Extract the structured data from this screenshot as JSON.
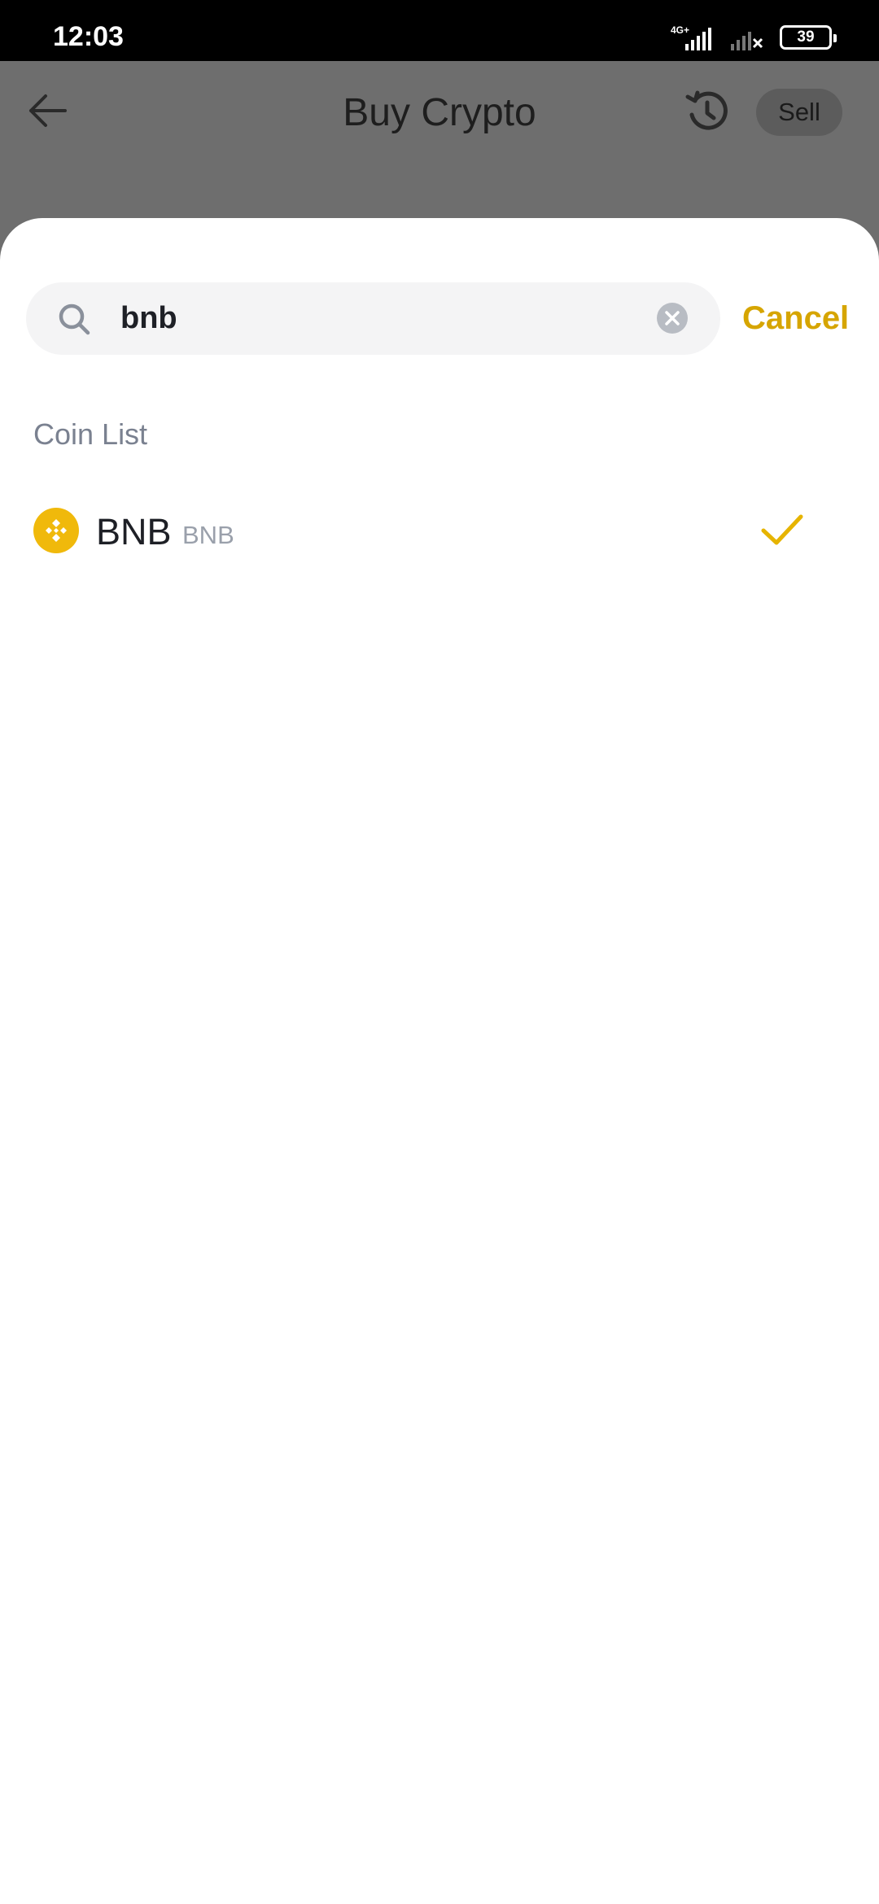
{
  "status_bar": {
    "time": "12:03",
    "network": "4G+",
    "battery": "39"
  },
  "header": {
    "title": "Buy Crypto",
    "sell_label": "Sell",
    "icons": [
      "back-arrow-icon",
      "history-icon"
    ]
  },
  "search": {
    "value": "bnb",
    "placeholder": "",
    "cancel_label": "Cancel"
  },
  "coin_list": {
    "label": "Coin List",
    "items": [
      {
        "name": "BNB",
        "symbol": "BNB",
        "selected": true,
        "logo_color": "#f0b90b"
      }
    ]
  },
  "colors": {
    "accent": "#d6a500",
    "coin_brand": "#f0b90b",
    "overlay": "#6e6e6e"
  }
}
